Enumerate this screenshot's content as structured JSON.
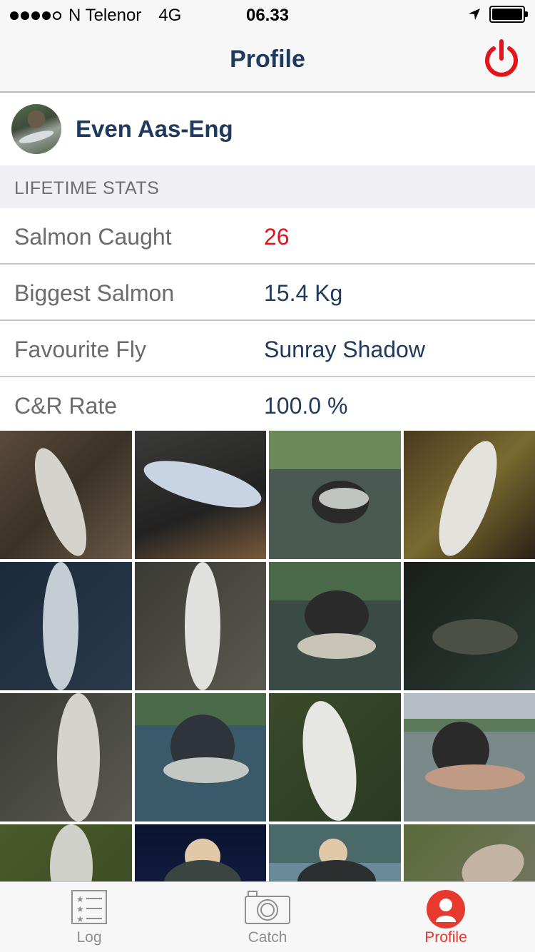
{
  "status_bar": {
    "carrier": "N Telenor",
    "network": "4G",
    "time": "06.33",
    "location_icon": "location-arrow-icon",
    "battery_icon": "battery-full-icon"
  },
  "nav": {
    "title": "Profile",
    "power_icon": "power-icon",
    "accent_color": "#e3141b"
  },
  "profile": {
    "name": "Even Aas-Eng"
  },
  "lifetime_stats": {
    "header": "LIFETIME STATS",
    "rows": [
      {
        "label": "Salmon Caught",
        "value": "26"
      },
      {
        "label": "Biggest Salmon",
        "value": "15.4 Kg"
      },
      {
        "label": "Favourite Fly",
        "value": "Sunray Shadow"
      },
      {
        "label": "C&R Rate",
        "value": "100.0 %"
      }
    ]
  },
  "photo_grid": {
    "count": 16
  },
  "tab_bar": {
    "tabs": [
      {
        "label": "Log",
        "icon": "list-icon"
      },
      {
        "label": "Catch",
        "icon": "camera-icon"
      },
      {
        "label": "Profile",
        "icon": "profile-icon",
        "active": true
      }
    ],
    "active_color": "#e8392e",
    "inactive_color": "#8e8e93"
  }
}
